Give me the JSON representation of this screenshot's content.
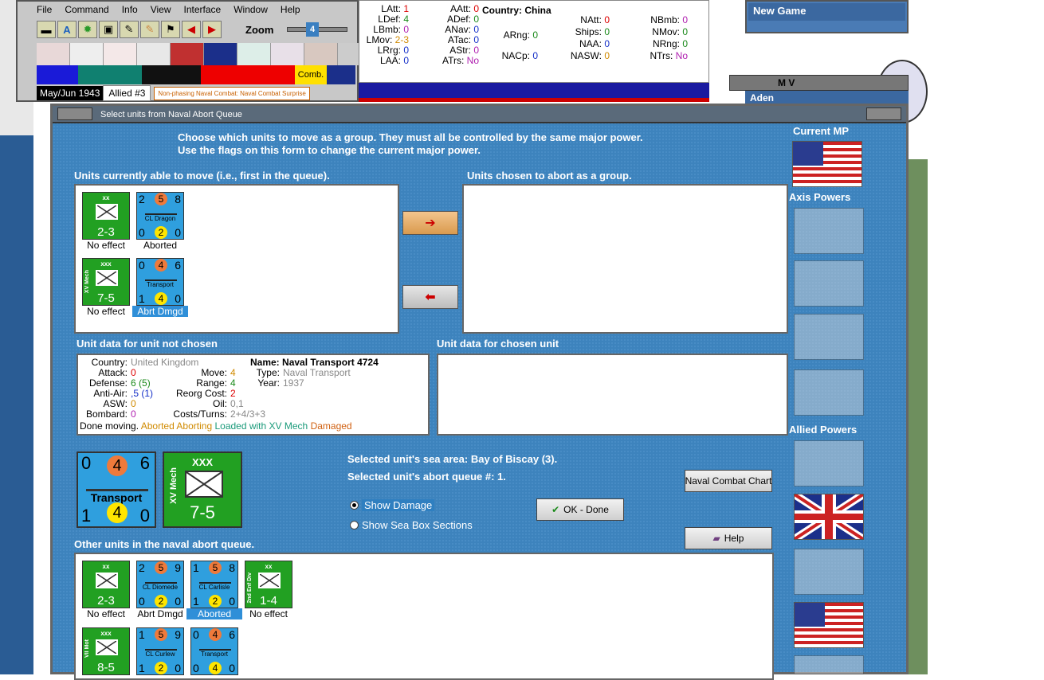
{
  "menu": {
    "items": [
      "File",
      "Command",
      "Info",
      "View",
      "Interface",
      "Window",
      "Help"
    ]
  },
  "toolbar": {
    "zoom_label": "Zoom",
    "zoom_value": "4",
    "comb_label": "Comb."
  },
  "status": {
    "date": "May/Jun 1943",
    "allied": "Allied #3",
    "phase": "Non-phasing Naval Combat: Naval Combat Surprise"
  },
  "stats": {
    "country_label": "Country:",
    "country": "China",
    "rows": [
      {
        "k": "LAtt:",
        "v": "1",
        "c": "v-red"
      },
      {
        "k": "LDef:",
        "v": "4",
        "c": "v-green"
      },
      {
        "k": "LBmb:",
        "v": "0",
        "c": "v-purple"
      },
      {
        "k": "LMov:",
        "v": "2-3",
        "c": "v-orange"
      },
      {
        "k": "LRrg:",
        "v": "0",
        "c": "v-blue"
      },
      {
        "k": "LAA:",
        "v": "0",
        "c": "v-blue"
      }
    ],
    "rows2": [
      {
        "k": "AAtt:",
        "v": "0",
        "c": "v-red"
      },
      {
        "k": "ADef:",
        "v": "0",
        "c": "v-green"
      },
      {
        "k": "ANav:",
        "v": "0",
        "c": "v-blue"
      },
      {
        "k": "ATac:",
        "v": "0",
        "c": "v-blue"
      },
      {
        "k": "AStr:",
        "v": "0",
        "c": "v-purple"
      },
      {
        "k": "ATrs:",
        "v": "No",
        "c": "v-purple"
      }
    ],
    "rows3": [
      {
        "k": "ARng:",
        "v": "0",
        "c": "v-green"
      },
      {
        "k": "NACp:",
        "v": "0",
        "c": "v-blue"
      }
    ],
    "rows4": [
      {
        "k": "NAtt:",
        "v": "0",
        "c": "v-red"
      },
      {
        "k": "Ships:",
        "v": "0",
        "c": "v-green"
      },
      {
        "k": "NAA:",
        "v": "0",
        "c": "v-blue"
      },
      {
        "k": "NASW:",
        "v": "0",
        "c": "v-orange"
      }
    ],
    "rows5": [
      {
        "k": "NBmb:",
        "v": "0",
        "c": "v-purple"
      },
      {
        "k": "NMov:",
        "v": "0",
        "c": "v-green"
      },
      {
        "k": "NRng:",
        "v": "0",
        "c": "v-green"
      },
      {
        "k": "NTrs:",
        "v": "No",
        "c": "v-purple"
      }
    ]
  },
  "side": {
    "new_game": "New Game",
    "mv": "M V",
    "aden": "Aden"
  },
  "dialog": {
    "title": "Select units from Naval Abort Queue",
    "instr1": "Choose which units to move as a group.  They must all be controlled by the same major power.",
    "instr2": "Use the flags on this form to change the current major power.",
    "sect_able": "Units currently able to move (i.e., first in the queue).",
    "sect_chosen": "Units chosen to abort as a group.",
    "sect_data_not": "Unit data for unit not chosen",
    "sect_data_chosen": "Unit data for chosen unit",
    "sect_other": "Other units in the naval abort queue.",
    "current_mp": "Current MP",
    "axis_powers": "Axis Powers",
    "allied_powers": "Allied Powers",
    "sea_area": "Selected unit's sea area: Bay of Biscay (3).",
    "abort_queue": "Selected unit's abort queue #: 1.",
    "show_damage": "Show Damage",
    "show_sea_box": "Show Sea Box Sections",
    "naval_chart": "Naval Combat Chart",
    "ok_done": "OK - Done",
    "help": "Help"
  },
  "able_units": [
    {
      "kind": "inf",
      "size": "xx",
      "str": "2-3",
      "label": "No effect"
    },
    {
      "kind": "ship",
      "tl": "2",
      "tm": "5",
      "tr": "8",
      "bl": "0",
      "bm": "2",
      "br": "0",
      "name": "CL Dragon",
      "label": "Aborted"
    },
    {
      "kind": "inf",
      "size": "xxx",
      "side": "XV Mech",
      "str": "7-5",
      "label": "No effect"
    },
    {
      "kind": "ship",
      "tl": "0",
      "tm": "4",
      "tr": "6",
      "bl": "1",
      "bm": "4",
      "br": "0",
      "name": "Transport",
      "label": "Abrt Dmgd"
    }
  ],
  "unit_data": {
    "country_k": "Country:",
    "country_v": "United Kingdom",
    "attack_k": "Attack:",
    "attack_v": "0",
    "defense_k": "Defense:",
    "defense_v": "6",
    "defense_v2": "(5)",
    "aa_k": "Anti-Air:",
    "aa_v": ",5",
    "aa_v2": "(1)",
    "asw_k": "ASW:",
    "asw_v": "0",
    "bombard_k": "Bombard:",
    "bombard_v": "0",
    "move_k": "Move:",
    "move_v": "4",
    "range_k": "Range:",
    "range_v": "4",
    "reorg_k": "Reorg Cost:",
    "reorg_v": "2",
    "oil_k": "Oil:",
    "oil_v": "0,1",
    "costs_k": "Costs/Turns:",
    "costs_v": "2+4/3+3",
    "name_k": "Name:",
    "name_v": "Naval Transport 4724",
    "type_k": "Type:",
    "type_v": "Naval Transport",
    "year_k": "Year:",
    "year_v": "1937",
    "done_k": "Done moving.",
    "s1": "Aborted",
    "s2": "Aborting",
    "s3": "Loaded with XV Mech",
    "s4": "Damaged"
  },
  "big_units": {
    "ship": {
      "tl": "0",
      "tm": "4",
      "tr": "6",
      "bl": "1",
      "bm": "4",
      "br": "0",
      "name": "Transport"
    },
    "inf": {
      "size": "XXX",
      "side": "XV Mech",
      "str": "7-5"
    }
  },
  "other_units": [
    {
      "kind": "inf",
      "size": "xx",
      "str": "2-3",
      "label": "No effect"
    },
    {
      "kind": "ship",
      "tl": "2",
      "tm": "5",
      "tr": "9",
      "bl": "0",
      "bm": "2",
      "br": "0",
      "name": "CL Diomede",
      "label": "Abrt Dmgd"
    },
    {
      "kind": "ship",
      "tl": "1",
      "tm": "5",
      "tr": "8",
      "bl": "1",
      "bm": "2",
      "br": "0",
      "name": "CL Carlisle",
      "label": "Aborted"
    },
    {
      "kind": "inf",
      "size": "xx",
      "side": "2nd Enf Div",
      "str": "1-4",
      "label": "No effect"
    },
    {
      "kind": "inf",
      "size": "xxx",
      "side": "VII Mot",
      "str": "8-5",
      "label": ""
    },
    {
      "kind": "ship",
      "tl": "1",
      "tm": "5",
      "tr": "9",
      "bl": "1",
      "bm": "2",
      "br": "0",
      "name": "CL Curlew",
      "label": ""
    },
    {
      "kind": "ship",
      "tl": "0",
      "tm": "4",
      "tr": "6",
      "bl": "0",
      "bm": "4",
      "br": "0",
      "name": "Transport",
      "label": ""
    }
  ]
}
